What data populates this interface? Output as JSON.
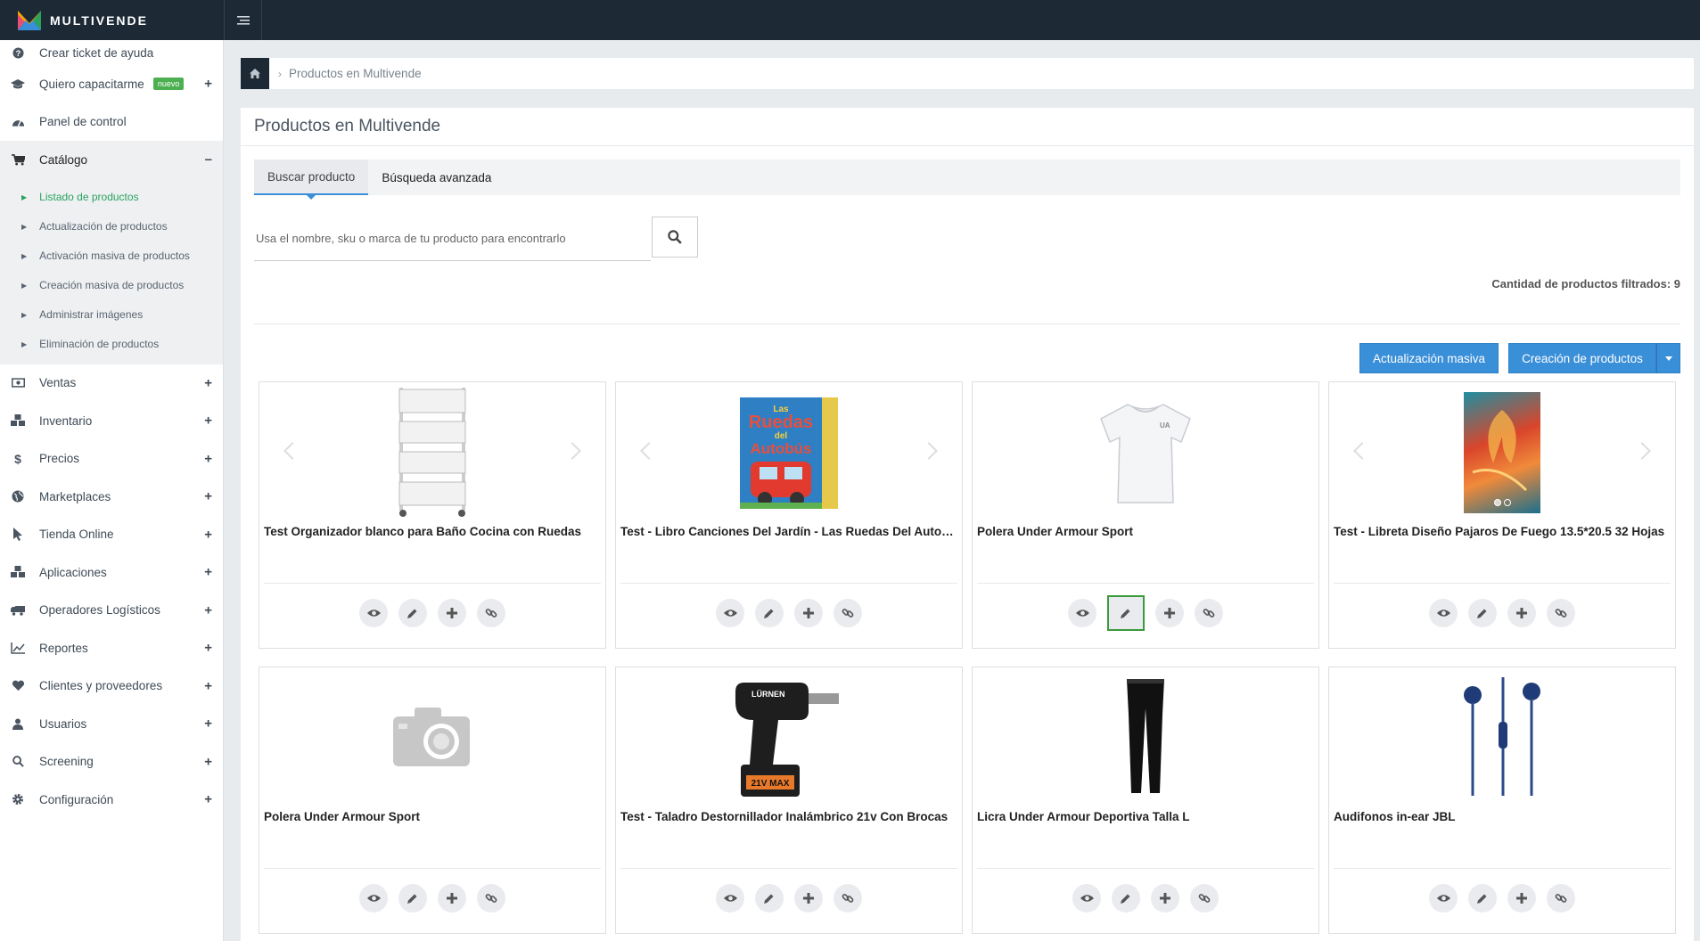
{
  "app": {
    "brand": "MULTIVENDE"
  },
  "sidebar": {
    "items": [
      {
        "label": "Crear ticket de ayuda",
        "icon": "question-circle-icon"
      },
      {
        "label": "Quiero capacitarme",
        "icon": "graduation-cap-icon",
        "badge": "nuevo",
        "expand": "+"
      },
      {
        "label": "Panel de control",
        "icon": "dashboard-icon"
      },
      {
        "label": "Catálogo",
        "icon": "cart-icon",
        "expand": "–"
      },
      {
        "label": "Ventas",
        "icon": "money-icon",
        "expand": "+"
      },
      {
        "label": "Inventario",
        "icon": "cubes-icon",
        "expand": "+"
      },
      {
        "label": "Precios",
        "icon": "dollar-icon",
        "expand": "+"
      },
      {
        "label": "Marketplaces",
        "icon": "globe-icon",
        "expand": "+"
      },
      {
        "label": "Tienda Online",
        "icon": "pointer-icon",
        "expand": "+"
      },
      {
        "label": "Aplicaciones",
        "icon": "cubes-icon",
        "expand": "+"
      },
      {
        "label": "Operadores Logísticos",
        "icon": "truck-icon",
        "expand": "+"
      },
      {
        "label": "Reportes",
        "icon": "line-chart-icon",
        "expand": "+"
      },
      {
        "label": "Clientes y proveedores",
        "icon": "heart-icon",
        "expand": "+"
      },
      {
        "label": "Usuarios",
        "icon": "user-icon",
        "expand": "+"
      },
      {
        "label": "Screening",
        "icon": "search-icon",
        "expand": "+"
      },
      {
        "label": "Configuración",
        "icon": "gear-icon",
        "expand": "+"
      }
    ],
    "catalog_sub": [
      "Listado de productos",
      "Actualización de productos",
      "Activación masiva de productos",
      "Creación masiva de productos",
      "Administrar imágenes",
      "Eliminación de productos"
    ]
  },
  "breadcrumb": {
    "current": "Productos en Multivende"
  },
  "main": {
    "title": "Productos en Multivende",
    "tabs": [
      {
        "label": "Buscar producto"
      },
      {
        "label": "Búsqueda avanzada"
      }
    ],
    "search": {
      "placeholder": "Usa el nombre, sku o marca de tu producto para encontrarlo",
      "value": ""
    },
    "count_text": "Cantidad de productos filtrados: 9",
    "buttons": {
      "mass_update": "Actualización masiva",
      "create": "Creación de productos"
    }
  },
  "products": [
    {
      "title": "Test Organizador blanco para Baño Cocina con Ruedas",
      "image": "shelf-organizer",
      "carousel": true
    },
    {
      "title": "Test - Libro Canciones Del Jardín - Las Ruedas Del Autobús",
      "image": "book-cover",
      "image_text": [
        "Las",
        "Ruedas",
        "del",
        "Autobús"
      ],
      "carousel": true
    },
    {
      "title": "Polera Under Armour Sport",
      "image": "white-tshirt",
      "carousel": false
    },
    {
      "title": "Test - Libreta Diseño Pajaros De Fuego 13.5*20.5 32 Hojas",
      "image": "notebook-phoenix",
      "carousel": true
    },
    {
      "title": "Polera Under Armour Sport",
      "image": "camera-placeholder",
      "carousel": false
    },
    {
      "title": "Test - Taladro Destornillador Inalámbrico 21v Con Brocas",
      "image": "cordless-drill",
      "image_text": [
        "LÜRNEN",
        "21V MAX"
      ],
      "carousel": false
    },
    {
      "title": "Licra Under Armour Deportiva Talla L",
      "image": "black-leggings",
      "carousel": false
    },
    {
      "title": "Audifonos in-ear JBL",
      "image": "blue-earphones",
      "carousel": false
    }
  ],
  "actions": [
    "view-icon",
    "edit-icon",
    "add-icon",
    "link-icon"
  ],
  "colors": {
    "topbar": "#1d2a36",
    "accent": "#3a8fd9",
    "active_sub": "#2aa35f",
    "badge": "#4caf50"
  }
}
